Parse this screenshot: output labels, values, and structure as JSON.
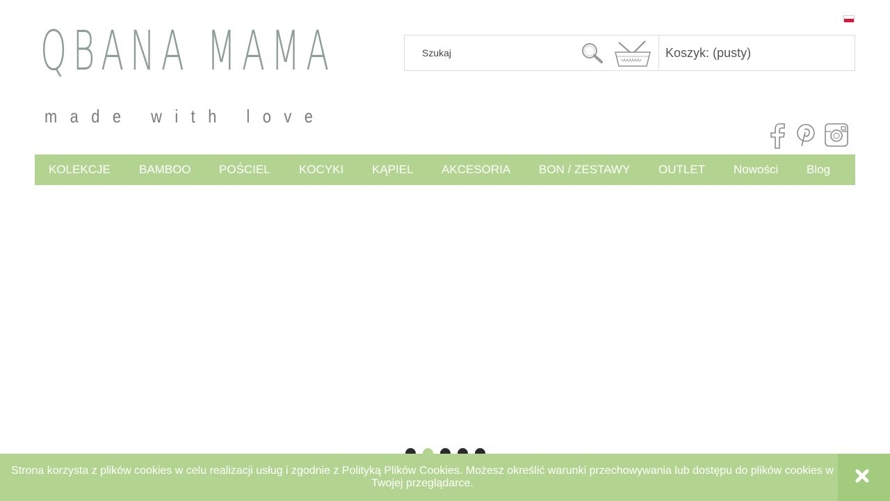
{
  "header": {
    "language_flag": "polish-flag-icon",
    "logo": {
      "name": "QBANA MAMA",
      "tagline": "made with love"
    }
  },
  "search": {
    "placeholder": "Szukaj",
    "icon": "search-icon"
  },
  "cart": {
    "icon": "basket-icon",
    "label": "Koszyk:",
    "status": "(pusty)"
  },
  "social": [
    "facebook-icon",
    "pinterest-icon",
    "instagram-icon"
  ],
  "nav": {
    "items": [
      {
        "label": "KOLEKCJE"
      },
      {
        "label": "BAMBOO"
      },
      {
        "label": "POŚCIEL"
      },
      {
        "label": "KOCYKI"
      },
      {
        "label": "KĄPIEL"
      },
      {
        "label": "AKCESORIA"
      },
      {
        "label": "BON / ZESTAWY"
      },
      {
        "label": "OUTLET"
      },
      {
        "label": "Nowości"
      },
      {
        "label": "Blog"
      }
    ]
  },
  "slider": {
    "dot_count": 5,
    "active_index": 2
  },
  "cookie_bar": {
    "text": "Strona korzysta z plików cookies w celu realizacji usług i zgodnie z Polityką Plików Cookies. Możesz określić warunki przechowywania lub dostępu do plików cookies w Twojej przeglądarce.",
    "close_icon": "close-icon"
  },
  "colors": {
    "accent_green": "#b2d490",
    "close_green": "#a3cb7e",
    "dot_dark": "#2b2b2b",
    "text_gray": "#555555"
  }
}
